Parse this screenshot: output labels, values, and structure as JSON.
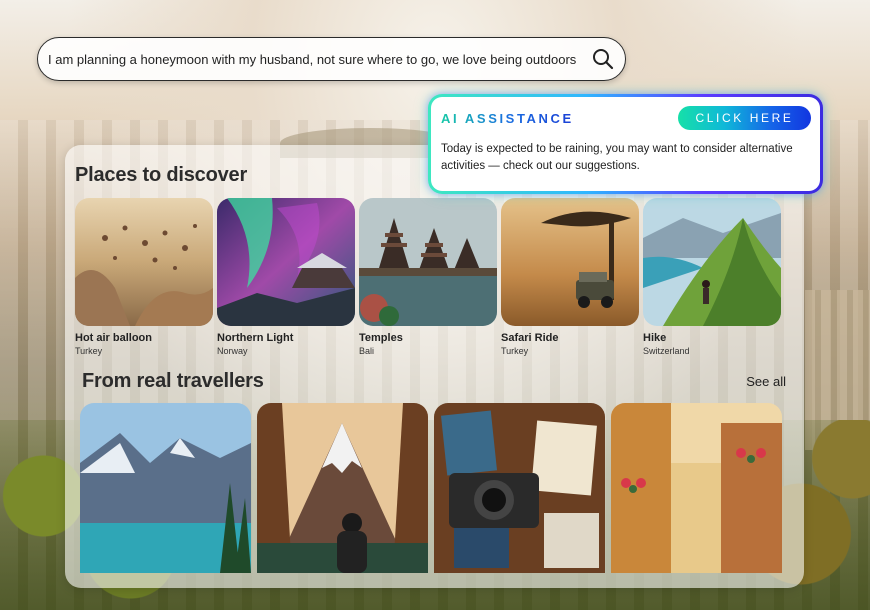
{
  "search": {
    "value": "I am planning a honeymoon with my husband, not sure where to go, we love being outdoors"
  },
  "ai_assistance": {
    "title": "AI ASSISTANCE",
    "button_label": "CLICK HERE",
    "message": "Today is expected to be raining, you may want to consider alternative activities — check out our suggestions."
  },
  "discover": {
    "title": "Places to discover",
    "places": [
      {
        "name": "Hot air balloon",
        "country": "Turkey"
      },
      {
        "name": "Northern Light",
        "country": "Norway"
      },
      {
        "name": "Temples",
        "country": "Bali"
      },
      {
        "name": "Safari Ride",
        "country": "Turkey"
      },
      {
        "name": "Hike",
        "country": "Switzerland"
      }
    ]
  },
  "travellers": {
    "title": "From real travellers",
    "see_all_label": "See all"
  },
  "colors": {
    "ai_gradient_start": "#16e0a8",
    "ai_gradient_end": "#1236e0",
    "panel_bg": "rgba(255,255,255,0.58)"
  }
}
